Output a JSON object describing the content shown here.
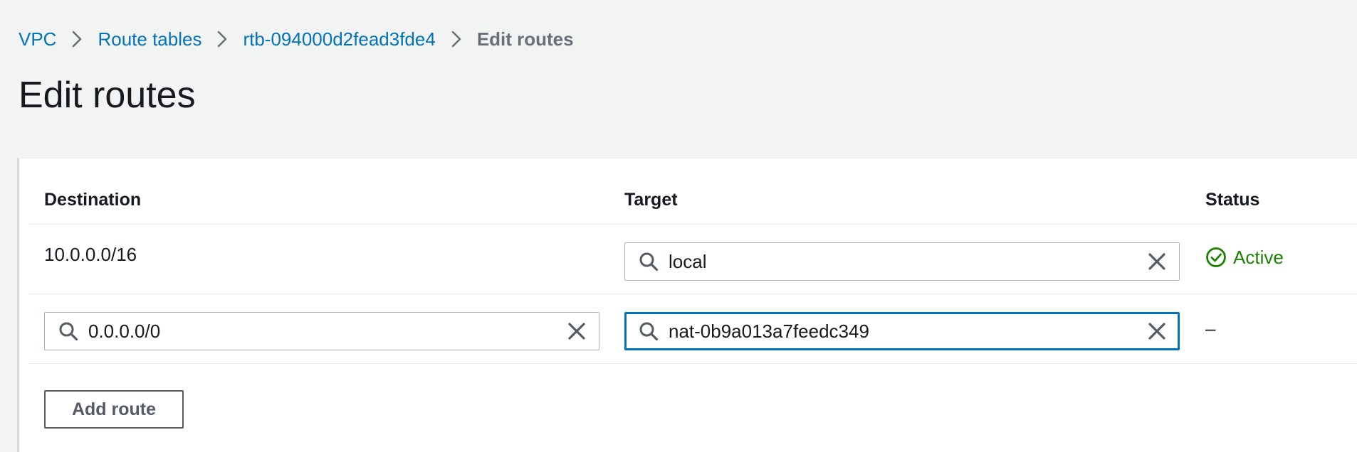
{
  "breadcrumb": {
    "items": [
      {
        "label": "VPC"
      },
      {
        "label": "Route tables"
      },
      {
        "label": "rtb-094000d2fead3fde4"
      }
    ],
    "current": "Edit routes"
  },
  "page": {
    "title": "Edit routes"
  },
  "table": {
    "columns": {
      "destination": "Destination",
      "target": "Target",
      "status": "Status"
    },
    "rows": [
      {
        "destination": "10.0.0.0/16",
        "target": "local",
        "status": "Active"
      },
      {
        "destination": "0.0.0.0/0",
        "target": "nat-0b9a013a7feedc349",
        "status": "–"
      }
    ]
  },
  "actions": {
    "add_route": "Add route"
  },
  "icons": {
    "breadcrumb_separator": "chevron-right-icon",
    "field_search": "search-icon",
    "field_clear": "close-icon",
    "status_active": "check-circle-icon"
  },
  "colors": {
    "link": "#0073bb",
    "success": "#1d8102",
    "focus": "#0073bb",
    "background": "#f2f3f3"
  }
}
